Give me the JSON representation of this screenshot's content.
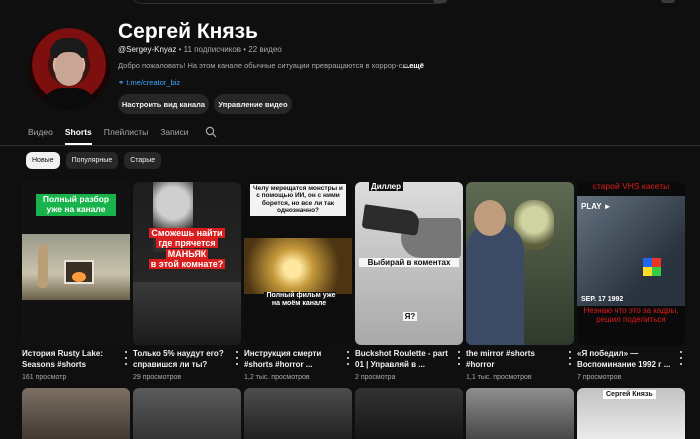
{
  "channel": {
    "name": "Сергей Князь",
    "handle": "@Sergey-Knyaz",
    "stats": " • 11 подписчиков • 22 видео",
    "description": "Добро пожаловать! На этом канале обычные ситуации превращаются в хоррор-сю...",
    "more": "...ещё",
    "link": "t.me/creator_biz",
    "buttons": {
      "customize": "Настроить вид канала",
      "manage": "Управление видео"
    }
  },
  "tabs": [
    "Видео",
    "Shorts",
    "Плейлисты",
    "Записи"
  ],
  "active_tab": "Shorts",
  "chips": [
    "Новые",
    "Популярные",
    "Старые"
  ],
  "active_chip": "Новые",
  "shorts": [
    {
      "title": "История Rusty Lake: Seasons #shorts",
      "views": "161 просмотр",
      "caption": "Полный разбор уже на канале"
    },
    {
      "title": "Только 5% наудут его? справишся ли ты?",
      "views": "29 просмотров",
      "caption_lines": [
        "Сможешь найти",
        "где прячется",
        "МАНЬЯК",
        "в этой комнате?"
      ]
    },
    {
      "title": "Инструкция смерти #shorts #horror ...",
      "views": "1,2 тыс. просмотров",
      "caption_top": "Челу мерещатся монстры и с помощью ИИ, он с ними борется, но все ли так однозначно?",
      "caption_bottom": "Полный фильм уже на моём канале"
    },
    {
      "title": "Buckshot Roulette - part 01 | Управляй в ...",
      "views": "2 просмотра",
      "caption_top": "Диллер",
      "caption_mid": "Выбирай в коментах",
      "caption_bottom": "Я?"
    },
    {
      "title": "the mirror #shorts #horror",
      "views": "1,1 тыс. просмотров"
    },
    {
      "title": "«Я победил» — Воспоминание 1992 г ...",
      "views": "7 просмотров",
      "caption_top": "старой VHS касеты",
      "play": "PLAY ►",
      "date": "SEP. 17 1992",
      "caption_bottom": "Незнаю что это за кадры, решил поделиться"
    }
  ],
  "row2_tag": "Сергей Князь"
}
